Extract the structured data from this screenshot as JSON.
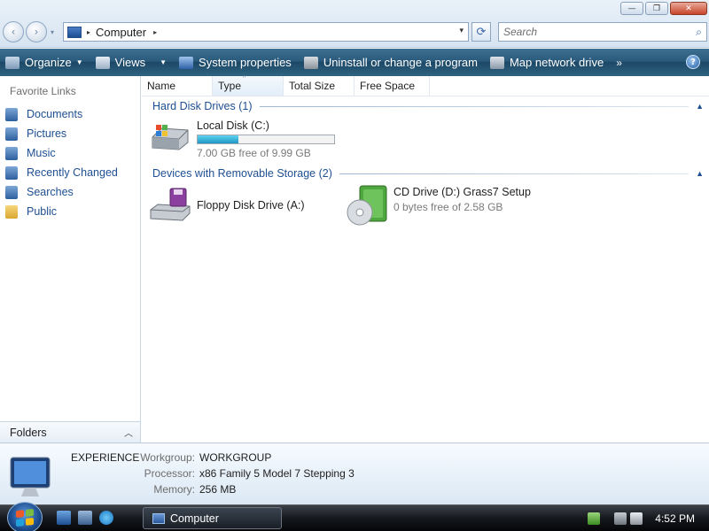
{
  "window": {
    "controls": {
      "minimize": "—",
      "maximize": "❐",
      "close": "✕"
    }
  },
  "navigation": {
    "back": "‹",
    "forward": "›",
    "history_drop": "▾"
  },
  "address": {
    "crumbs": [
      "Computer"
    ],
    "separator": "▸",
    "dropdown": "▾",
    "refresh": "⟳"
  },
  "search": {
    "placeholder": "Search",
    "icon": "⌕"
  },
  "toolbar": {
    "organize": "Organize",
    "views": "Views",
    "system_properties": "System properties",
    "uninstall": "Uninstall or change a program",
    "map_drive": "Map network drive",
    "more": "»",
    "help": "?"
  },
  "sidebar": {
    "header": "Favorite Links",
    "items": [
      {
        "label": "Documents",
        "icon": "documents-icon"
      },
      {
        "label": "Pictures",
        "icon": "pictures-icon"
      },
      {
        "label": "Music",
        "icon": "music-icon"
      },
      {
        "label": "Recently Changed",
        "icon": "recently-changed-icon"
      },
      {
        "label": "Searches",
        "icon": "searches-icon"
      },
      {
        "label": "Public",
        "icon": "public-folder-icon"
      }
    ],
    "folders": "Folders",
    "folders_chevron": "︿"
  },
  "columns": {
    "name": "Name",
    "type": "Type",
    "total_size": "Total Size",
    "free_space": "Free Space"
  },
  "groups": {
    "hard_disks": {
      "title": "Hard Disk Drives (1)",
      "drives": [
        {
          "name": "Local Disk (C:)",
          "usage_fraction": 0.3,
          "free_text": "7.00 GB free of 9.99 GB"
        }
      ]
    },
    "removable": {
      "title": "Devices with Removable Storage (2)",
      "drives": [
        {
          "name": "Floppy Disk Drive (A:)"
        },
        {
          "name": "CD Drive (D:) Grass7 Setup",
          "free_text": "0 bytes free of 2.58 GB"
        }
      ]
    }
  },
  "details": {
    "computer_name": "EXPERIENCE",
    "workgroup_label": "Workgroup:",
    "workgroup": "WORKGROUP",
    "processor_label": "Processor:",
    "processor": "x86 Family 5 Model 7 Stepping 3",
    "memory_label": "Memory:",
    "memory": "256 MB"
  },
  "taskbar": {
    "window_button": "Computer",
    "clock": "4:52 PM"
  },
  "colors": {
    "command_bar": "#2a5a7c",
    "link_blue": "#1e4f92",
    "usage_fill": "#1f97c4"
  }
}
